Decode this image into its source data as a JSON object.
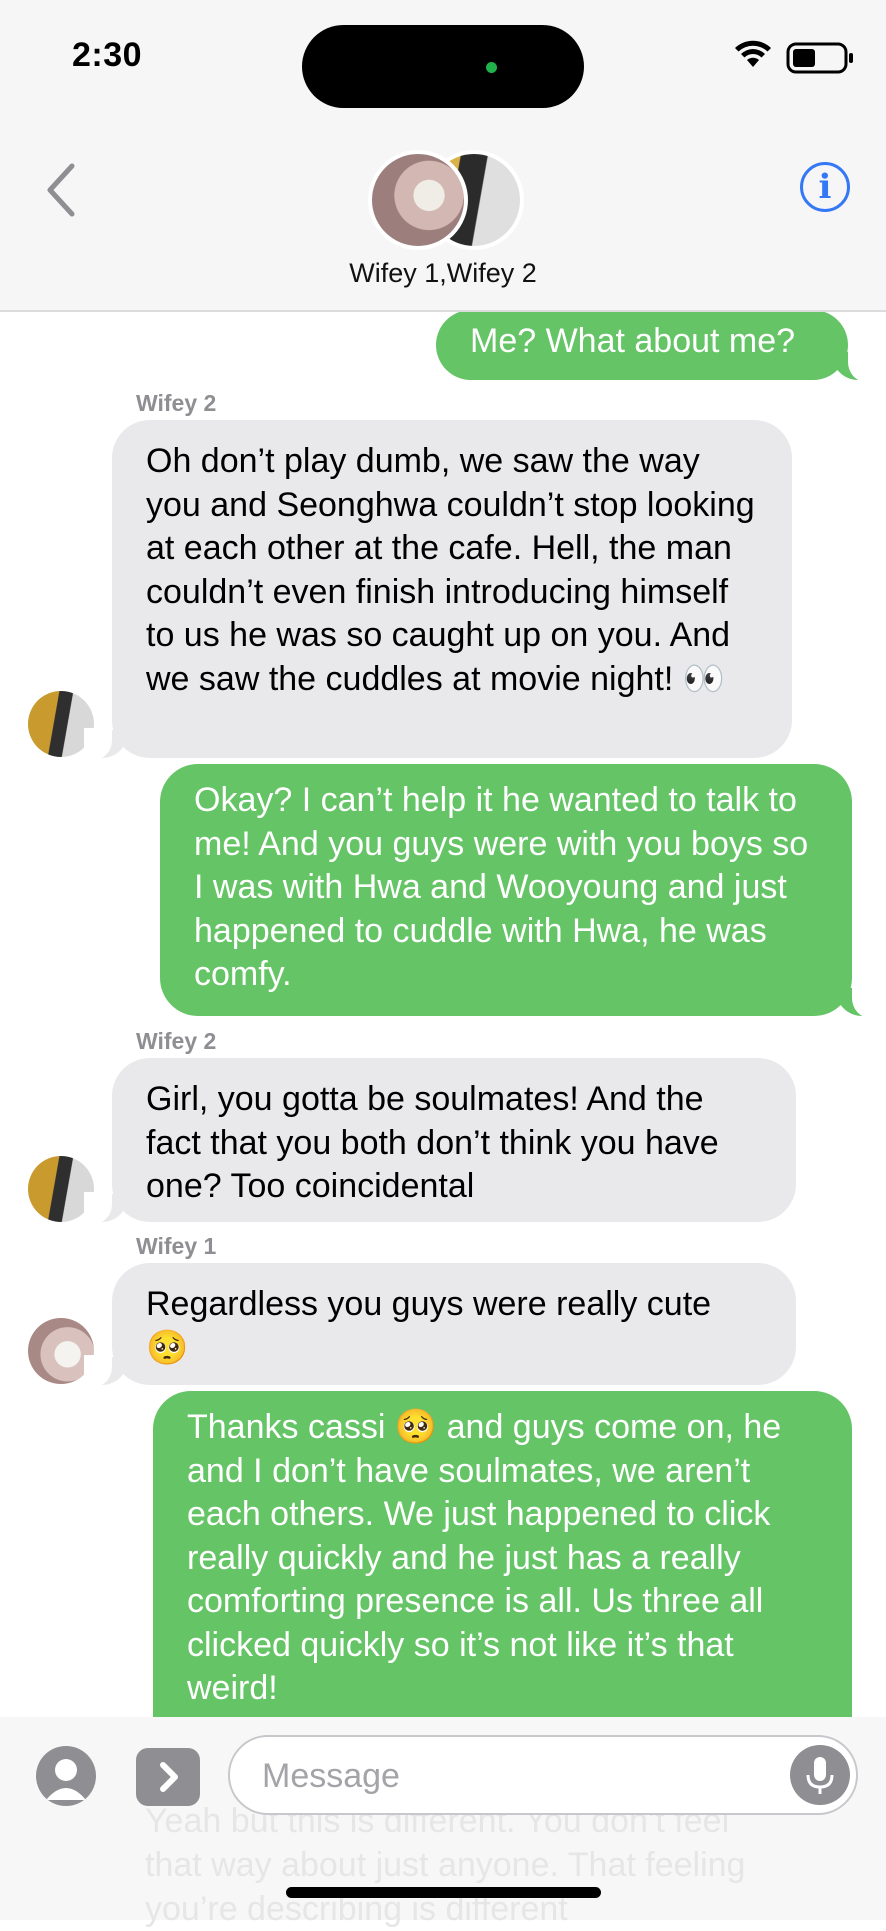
{
  "status_bar": {
    "time": "2:30"
  },
  "header": {
    "group_name": "Wifey 1,Wifey 2",
    "info_icon": "i"
  },
  "messages": [
    {
      "direction": "outgoing",
      "text": "Me? What about me?"
    },
    {
      "direction": "incoming",
      "sender": "Wifey 2",
      "text": "Oh don’t play dumb, we saw the way you and Seonghwa couldn’t stop looking at each other at the cafe. Hell, the man couldn’t even finish introducing himself to us he was so caught up on you. And we saw the cuddles at movie night! 👀"
    },
    {
      "direction": "outgoing",
      "text": "Okay? I can’t help it he wanted to talk to me! And you guys were with you boys so I was with Hwa and Wooyoung and just happened to cuddle with Hwa, he was comfy."
    },
    {
      "direction": "incoming",
      "sender": "Wifey 2",
      "text": "Girl, you gotta be soulmates! And the fact that you both don’t think you have one? Too coincidental"
    },
    {
      "direction": "incoming",
      "sender": "Wifey 1",
      "text": "Regardless you guys were really cute 🥺"
    },
    {
      "direction": "outgoing",
      "text": "Thanks cassi 🥺 and guys come on, he and I don’t have soulmates, we aren’t each others. We just happened to click really quickly and he just has a really comforting presence is all. Us three all clicked quickly so it’s not like it’s that weird!"
    }
  ],
  "compose": {
    "placeholder": "Message",
    "ghost_text": "Yeah but this is different. You don’t feel that way about just anyone. That feeling you’re describing is different"
  },
  "colors": {
    "outgoing_bubble": "#65c466",
    "incoming_bubble": "#e9e9eb",
    "accent": "#3478f6"
  },
  "icons": [
    "back-chevron-icon",
    "info-icon",
    "wifi-icon",
    "battery-icon",
    "camera-icon",
    "apps-icon",
    "microphone-icon"
  ]
}
